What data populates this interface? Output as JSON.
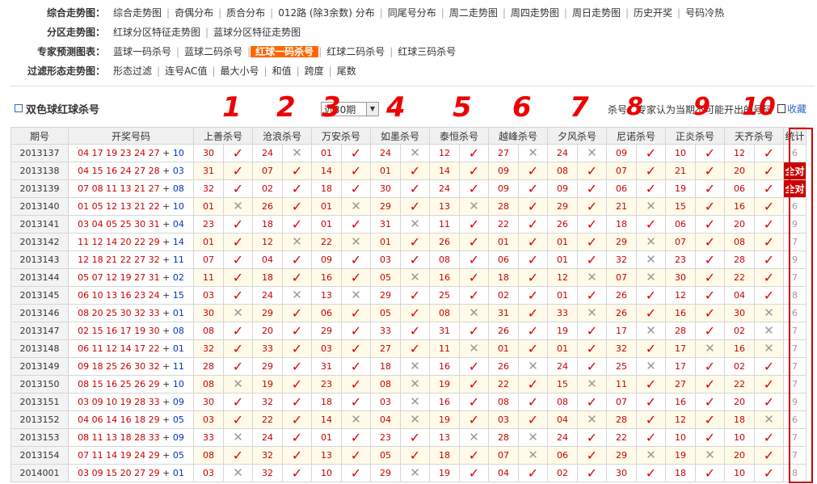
{
  "nav": [
    {
      "label": "综合走势图：",
      "links": [
        "综合走势图",
        "奇偶分布",
        "质合分布",
        "012路 (除3余数) 分布",
        "同尾号分布",
        "周二走势图",
        "周四走势图",
        "周日走势图",
        "历史开奖",
        "号码冷热"
      ]
    },
    {
      "label": "分区走势图：",
      "links": [
        "红球分区特征走势图",
        "蓝球分区特征走势图"
      ]
    },
    {
      "label": "专家预测图表：",
      "links": [
        "蓝球一码杀号",
        "蓝球二码杀号",
        "红球一码杀号",
        "红球二码杀号",
        "红球三码杀号"
      ],
      "active": 2
    },
    {
      "label": "过滤形态走势图：",
      "links": [
        "形态过滤",
        "连号AC值",
        "最大小号",
        "和值",
        "跨度",
        "尾数"
      ]
    }
  ],
  "title": "双色球红球杀号",
  "period_select": "近30期",
  "note": "杀号：专家认为当期不可能开出的号码",
  "favorite": "收藏",
  "annotations": [
    "1",
    "2",
    "3",
    "4",
    "5",
    "6",
    "7",
    "8",
    "9",
    "10"
  ],
  "headers": {
    "issue": "期号",
    "draw": "开奖号码",
    "experts": [
      "上善杀号",
      "沧浪杀号",
      "万安杀号",
      "如墨杀号",
      "泰恒杀号",
      "越峰杀号",
      "夕风杀号",
      "尼诺杀号",
      "正炎杀号",
      "天齐杀号"
    ],
    "stat": "统计"
  },
  "rows": [
    {
      "issue": "2013137",
      "reds": "04 17 19 23 24 27",
      "blue": "10",
      "kills": [
        [
          "30",
          1
        ],
        [
          "24",
          0
        ],
        [
          "01",
          1
        ],
        [
          "24",
          0
        ],
        [
          "12",
          1
        ],
        [
          "27",
          0
        ],
        [
          "24",
          0
        ],
        [
          "09",
          1
        ],
        [
          "10",
          1
        ],
        [
          "12",
          1
        ]
      ],
      "stat": "6"
    },
    {
      "issue": "2013138",
      "reds": "04 15 16 24 27 28",
      "blue": "03",
      "kills": [
        [
          "31",
          1
        ],
        [
          "07",
          1
        ],
        [
          "14",
          1
        ],
        [
          "01",
          1
        ],
        [
          "14",
          1
        ],
        [
          "09",
          1
        ],
        [
          "08",
          1
        ],
        [
          "07",
          1
        ],
        [
          "21",
          1
        ],
        [
          "20",
          1
        ]
      ],
      "stat": "全对"
    },
    {
      "issue": "2013139",
      "reds": "07 08 11 13 21 27",
      "blue": "08",
      "kills": [
        [
          "32",
          1
        ],
        [
          "02",
          1
        ],
        [
          "18",
          1
        ],
        [
          "30",
          1
        ],
        [
          "24",
          1
        ],
        [
          "09",
          1
        ],
        [
          "09",
          1
        ],
        [
          "06",
          1
        ],
        [
          "19",
          1
        ],
        [
          "06",
          1
        ]
      ],
      "stat": "全对"
    },
    {
      "issue": "2013140",
      "reds": "01 05 12 13 21 22",
      "blue": "10",
      "kills": [
        [
          "01",
          0
        ],
        [
          "26",
          1
        ],
        [
          "01",
          0
        ],
        [
          "29",
          1
        ],
        [
          "13",
          0
        ],
        [
          "28",
          1
        ],
        [
          "29",
          1
        ],
        [
          "21",
          0
        ],
        [
          "15",
          1
        ],
        [
          "16",
          1
        ]
      ],
      "stat": "6"
    },
    {
      "issue": "2013141",
      "reds": "03 04 05 25 30 31",
      "blue": "04",
      "kills": [
        [
          "23",
          1
        ],
        [
          "18",
          1
        ],
        [
          "01",
          1
        ],
        [
          "31",
          0
        ],
        [
          "11",
          1
        ],
        [
          "22",
          1
        ],
        [
          "26",
          1
        ],
        [
          "18",
          1
        ],
        [
          "06",
          1
        ],
        [
          "20",
          1
        ]
      ],
      "stat": "9"
    },
    {
      "issue": "2013142",
      "reds": "11 12 14 20 22 29",
      "blue": "14",
      "kills": [
        [
          "01",
          1
        ],
        [
          "12",
          0
        ],
        [
          "22",
          0
        ],
        [
          "01",
          1
        ],
        [
          "26",
          1
        ],
        [
          "01",
          1
        ],
        [
          "01",
          1
        ],
        [
          "29",
          0
        ],
        [
          "07",
          1
        ],
        [
          "08",
          1
        ]
      ],
      "stat": "7"
    },
    {
      "issue": "2013143",
      "reds": "12 18 21 22 27 32",
      "blue": "11",
      "kills": [
        [
          "07",
          1
        ],
        [
          "04",
          1
        ],
        [
          "09",
          1
        ],
        [
          "03",
          1
        ],
        [
          "08",
          1
        ],
        [
          "06",
          1
        ],
        [
          "01",
          1
        ],
        [
          "32",
          0
        ],
        [
          "23",
          1
        ],
        [
          "28",
          1
        ]
      ],
      "stat": "9"
    },
    {
      "issue": "2013144",
      "reds": "05 07 12 19 27 31",
      "blue": "02",
      "kills": [
        [
          "11",
          1
        ],
        [
          "18",
          1
        ],
        [
          "16",
          1
        ],
        [
          "05",
          0
        ],
        [
          "16",
          1
        ],
        [
          "18",
          1
        ],
        [
          "12",
          0
        ],
        [
          "07",
          0
        ],
        [
          "30",
          1
        ],
        [
          "22",
          1
        ]
      ],
      "stat": "7"
    },
    {
      "issue": "2013145",
      "reds": "06 10 13 16 23 24",
      "blue": "15",
      "kills": [
        [
          "03",
          1
        ],
        [
          "24",
          0
        ],
        [
          "13",
          0
        ],
        [
          "29",
          1
        ],
        [
          "25",
          1
        ],
        [
          "02",
          1
        ],
        [
          "01",
          1
        ],
        [
          "26",
          1
        ],
        [
          "12",
          1
        ],
        [
          "04",
          1
        ]
      ],
      "stat": "8"
    },
    {
      "issue": "2013146",
      "reds": "08 20 25 30 32 33",
      "blue": "01",
      "kills": [
        [
          "30",
          0
        ],
        [
          "29",
          1
        ],
        [
          "06",
          1
        ],
        [
          "05",
          1
        ],
        [
          "08",
          0
        ],
        [
          "31",
          1
        ],
        [
          "33",
          0
        ],
        [
          "26",
          1
        ],
        [
          "16",
          1
        ],
        [
          "30",
          0
        ]
      ],
      "stat": "6"
    },
    {
      "issue": "2013147",
      "reds": "02 15 16 17 19 30",
      "blue": "08",
      "kills": [
        [
          "08",
          1
        ],
        [
          "20",
          1
        ],
        [
          "29",
          1
        ],
        [
          "33",
          1
        ],
        [
          "31",
          1
        ],
        [
          "26",
          1
        ],
        [
          "19",
          1
        ],
        [
          "17",
          0
        ],
        [
          "28",
          1
        ],
        [
          "02",
          0
        ]
      ],
      "stat": "7"
    },
    {
      "issue": "2013148",
      "reds": "06 11 12 14 17 22",
      "blue": "01",
      "kills": [
        [
          "32",
          1
        ],
        [
          "33",
          1
        ],
        [
          "03",
          1
        ],
        [
          "27",
          1
        ],
        [
          "11",
          0
        ],
        [
          "01",
          1
        ],
        [
          "01",
          1
        ],
        [
          "32",
          1
        ],
        [
          "17",
          0
        ],
        [
          "16",
          0
        ]
      ],
      "stat": "7"
    },
    {
      "issue": "2013149",
      "reds": "09 18 25 26 30 32",
      "blue": "11",
      "kills": [
        [
          "28",
          1
        ],
        [
          "29",
          1
        ],
        [
          "31",
          1
        ],
        [
          "18",
          0
        ],
        [
          "16",
          1
        ],
        [
          "26",
          0
        ],
        [
          "24",
          1
        ],
        [
          "25",
          0
        ],
        [
          "17",
          1
        ],
        [
          "02",
          1
        ]
      ],
      "stat": "7"
    },
    {
      "issue": "2013150",
      "reds": "08 15 16 25 26 29",
      "blue": "10",
      "kills": [
        [
          "08",
          0
        ],
        [
          "19",
          1
        ],
        [
          "23",
          1
        ],
        [
          "08",
          0
        ],
        [
          "19",
          1
        ],
        [
          "22",
          1
        ],
        [
          "15",
          0
        ],
        [
          "11",
          1
        ],
        [
          "27",
          1
        ],
        [
          "22",
          1
        ]
      ],
      "stat": "7"
    },
    {
      "issue": "2013151",
      "reds": "03 09 10 19 28 33",
      "blue": "09",
      "kills": [
        [
          "30",
          1
        ],
        [
          "32",
          1
        ],
        [
          "18",
          1
        ],
        [
          "03",
          0
        ],
        [
          "16",
          1
        ],
        [
          "08",
          1
        ],
        [
          "08",
          1
        ],
        [
          "07",
          1
        ],
        [
          "16",
          1
        ],
        [
          "20",
          1
        ]
      ],
      "stat": "9"
    },
    {
      "issue": "2013152",
      "reds": "04 06 14 16 18 29",
      "blue": "05",
      "kills": [
        [
          "03",
          1
        ],
        [
          "22",
          1
        ],
        [
          "14",
          0
        ],
        [
          "04",
          0
        ],
        [
          "19",
          1
        ],
        [
          "03",
          1
        ],
        [
          "04",
          0
        ],
        [
          "28",
          1
        ],
        [
          "12",
          1
        ],
        [
          "18",
          0
        ]
      ],
      "stat": "6"
    },
    {
      "issue": "2013153",
      "reds": "08 11 13 18 28 33",
      "blue": "09",
      "kills": [
        [
          "33",
          0
        ],
        [
          "24",
          1
        ],
        [
          "01",
          1
        ],
        [
          "23",
          1
        ],
        [
          "13",
          0
        ],
        [
          "28",
          0
        ],
        [
          "24",
          1
        ],
        [
          "22",
          1
        ],
        [
          "10",
          1
        ],
        [
          "10",
          1
        ]
      ],
      "stat": "7"
    },
    {
      "issue": "2013154",
      "reds": "07 11 14 19 24 29",
      "blue": "05",
      "kills": [
        [
          "08",
          1
        ],
        [
          "32",
          1
        ],
        [
          "13",
          1
        ],
        [
          "05",
          1
        ],
        [
          "18",
          1
        ],
        [
          "07",
          0
        ],
        [
          "06",
          1
        ],
        [
          "29",
          0
        ],
        [
          "19",
          0
        ],
        [
          "20",
          1
        ]
      ],
      "stat": "7"
    },
    {
      "issue": "2014001",
      "reds": "03 09 15 20 27 29",
      "blue": "01",
      "kills": [
        [
          "03",
          0
        ],
        [
          "32",
          1
        ],
        [
          "10",
          1
        ],
        [
          "29",
          0
        ],
        [
          "19",
          1
        ],
        [
          "04",
          1
        ],
        [
          "02",
          1
        ],
        [
          "30",
          1
        ],
        [
          "18",
          1
        ],
        [
          "10",
          1
        ]
      ],
      "stat": "8"
    }
  ],
  "colors": {
    "active_tab": "#ff6600",
    "red": "#cc0000",
    "blue": "#0033cc",
    "frame": "#d40000"
  }
}
